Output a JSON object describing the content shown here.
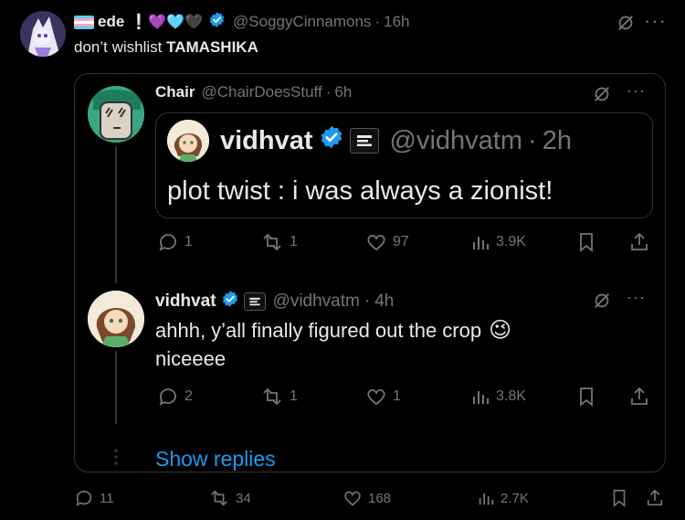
{
  "main_post": {
    "display_name": "ede",
    "name_emoji": "❕💜🩵🖤",
    "handle": "@SoggyCinnamons",
    "time": "16h",
    "text_prefix": "don’t wishlist ",
    "text_bold": "TAMASHIKA",
    "stats": {
      "replies": "11",
      "reposts": "34",
      "likes": "168",
      "views": "2.7K"
    }
  },
  "reply1": {
    "display_name": "Chair",
    "handle": "@ChairDoesStuff",
    "time": "6h",
    "stats": {
      "replies": "1",
      "reposts": "1",
      "likes": "97",
      "views": "3.9K"
    }
  },
  "quote": {
    "display_name": "vidhvat",
    "handle": "@vidhvatm",
    "time": "2h",
    "text": "plot twist : i was always a zionist!"
  },
  "reply2": {
    "display_name": "vidhvat",
    "handle": "@vidhvatm",
    "time": "4h",
    "text_line1": "ahhh, y’all finally figured out the crop",
    "emoji": "😉",
    "text_line2": "niceeee",
    "stats": {
      "replies": "2",
      "reposts": "1",
      "likes": "1",
      "views": "3.8K"
    }
  },
  "show_replies_label": "Show replies",
  "separator": "·",
  "more_label": "···",
  "colors": {
    "accent": "#1d9bf0",
    "background": "#000000",
    "text": "#e7e9ea",
    "muted": "#71767b",
    "border": "#2f3336"
  }
}
